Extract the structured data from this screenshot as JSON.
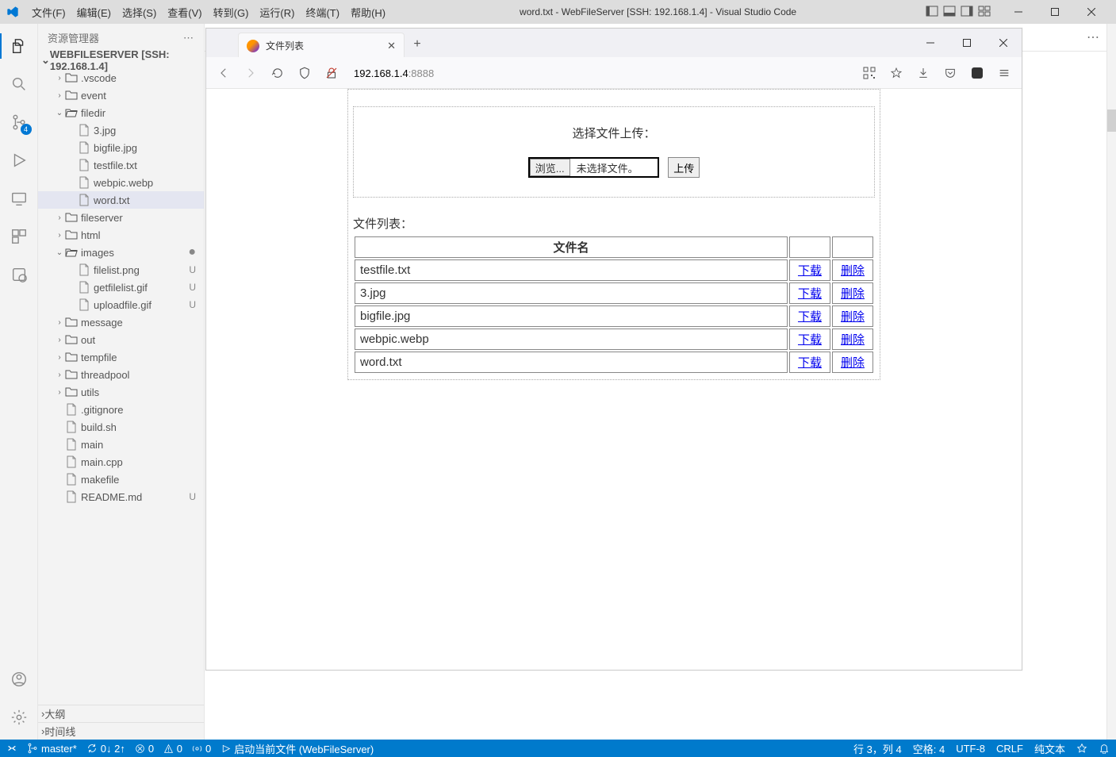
{
  "title": "word.txt - WebFileServer [SSH: 192.168.1.4] - Visual Studio Code",
  "menubar": [
    "文件(F)",
    "编辑(E)",
    "选择(S)",
    "查看(V)",
    "转到(G)",
    "运行(R)",
    "终端(T)",
    "帮助(H)"
  ],
  "activity_badge": "4",
  "sidebar": {
    "header": "资源管理器",
    "root": "WEBFILESERVER [SSH: 192.168.1.4]",
    "items": [
      {
        "type": "folder",
        "state": "closed",
        "label": ".vscode",
        "indent": 1
      },
      {
        "type": "folder",
        "state": "closed",
        "label": "event",
        "indent": 1
      },
      {
        "type": "folder",
        "state": "open",
        "label": "filedir",
        "indent": 1
      },
      {
        "type": "file",
        "label": "3.jpg",
        "indent": 2
      },
      {
        "type": "file",
        "label": "bigfile.jpg",
        "indent": 2
      },
      {
        "type": "file",
        "label": "testfile.txt",
        "indent": 2
      },
      {
        "type": "file",
        "label": "webpic.webp",
        "indent": 2
      },
      {
        "type": "file",
        "label": "word.txt",
        "indent": 2,
        "selected": true
      },
      {
        "type": "folder",
        "state": "closed",
        "label": "fileserver",
        "indent": 1
      },
      {
        "type": "folder",
        "state": "closed",
        "label": "html",
        "indent": 1
      },
      {
        "type": "folder",
        "state": "open",
        "label": "images",
        "indent": 1,
        "dot": true
      },
      {
        "type": "file",
        "label": "filelist.png",
        "indent": 2,
        "decor": "U"
      },
      {
        "type": "file",
        "label": "getfilelist.gif",
        "indent": 2,
        "decor": "U"
      },
      {
        "type": "file",
        "label": "uploadfile.gif",
        "indent": 2,
        "decor": "U"
      },
      {
        "type": "folder",
        "state": "closed",
        "label": "message",
        "indent": 1
      },
      {
        "type": "folder",
        "state": "closed",
        "label": "out",
        "indent": 1
      },
      {
        "type": "folder",
        "state": "closed",
        "label": "tempfile",
        "indent": 1
      },
      {
        "type": "folder",
        "state": "closed",
        "label": "threadpool",
        "indent": 1
      },
      {
        "type": "folder",
        "state": "closed",
        "label": "utils",
        "indent": 1
      },
      {
        "type": "file",
        "label": ".gitignore",
        "indent": 1
      },
      {
        "type": "file",
        "label": "build.sh",
        "indent": 1
      },
      {
        "type": "file",
        "label": "main",
        "indent": 1
      },
      {
        "type": "file",
        "label": "main.cpp",
        "indent": 1
      },
      {
        "type": "file",
        "label": "makefile",
        "indent": 1
      },
      {
        "type": "file",
        "label": "README.md",
        "indent": 1,
        "decor": "U"
      }
    ],
    "outline": "大纲",
    "timeline": "时间线"
  },
  "browser": {
    "tab_title": "文件列表",
    "url_host": "192.168.1.4",
    "url_port": ":8888",
    "upload": {
      "heading": "选择文件上传：",
      "browse": "浏览...",
      "nofile": "未选择文件。",
      "submit": "上传"
    },
    "list_label": "文件列表：",
    "col_filename": "文件名",
    "dl": "下载",
    "del": "删除",
    "files": [
      "testfile.txt",
      "3.jpg",
      "bigfile.jpg",
      "webpic.webp",
      "word.txt"
    ]
  },
  "status": {
    "branch": "master*",
    "sync": "0↓ 2↑",
    "errors": "0",
    "warnings": "0",
    "ports": "0",
    "launch": "启动当前文件 (WebFileServer)",
    "lncol": "行 3，列 4",
    "spaces": "空格: 4",
    "encoding": "UTF-8",
    "eol": "CRLF",
    "lang": "纯文本"
  }
}
